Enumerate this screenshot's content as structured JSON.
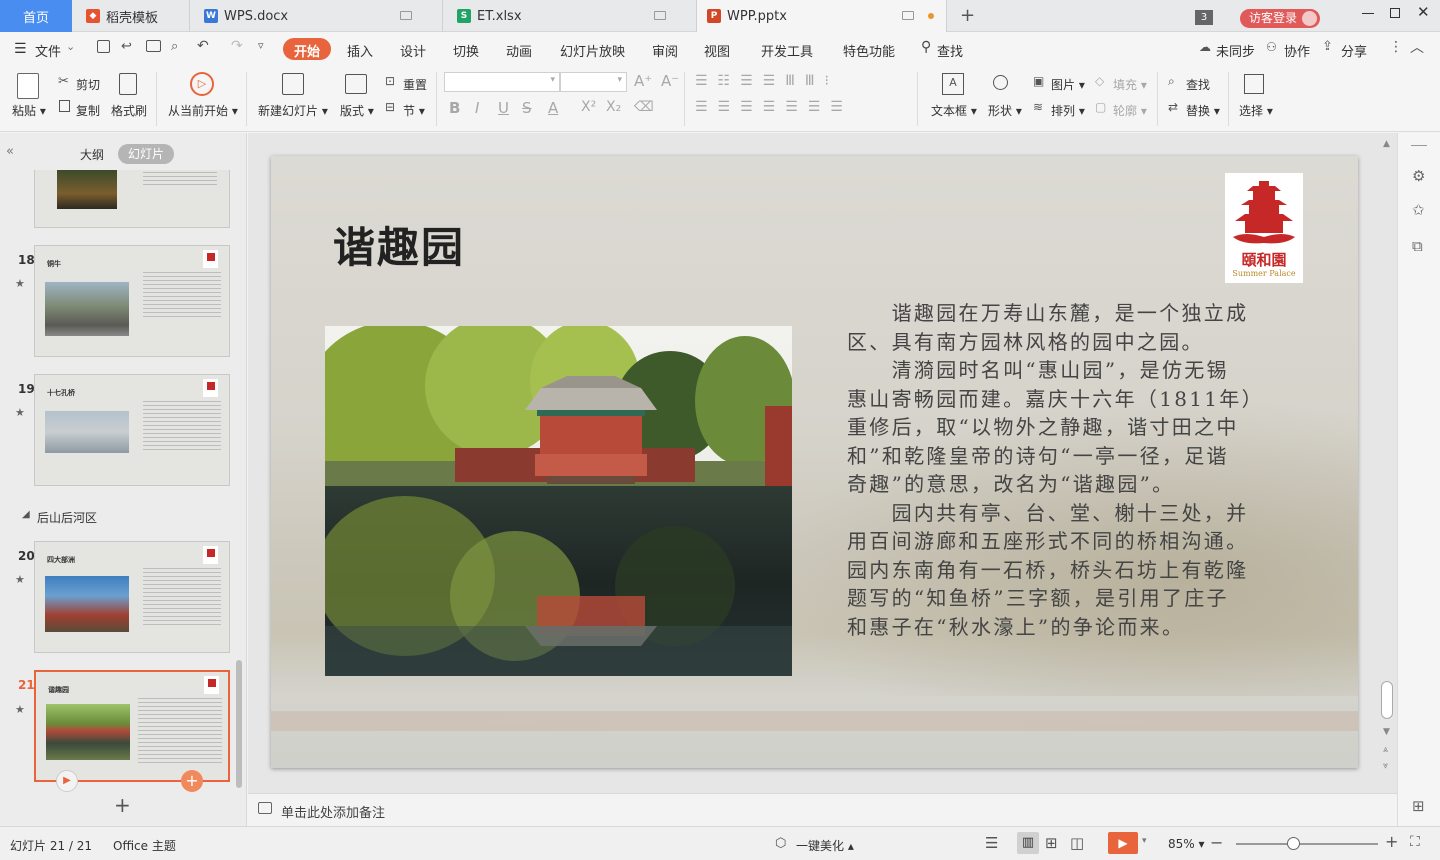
{
  "tabs": {
    "home": "首页",
    "items": [
      {
        "label": "稻壳模板",
        "icon": "daoke-icon"
      },
      {
        "label": "WPS.docx",
        "icon": "docx-icon"
      },
      {
        "label": "ET.xlsx",
        "icon": "xlsx-icon"
      },
      {
        "label": "WPP.pptx",
        "icon": "pptx-icon"
      }
    ],
    "add": "+",
    "badge": "3",
    "login": "访客登录"
  },
  "menu": {
    "file": "文件",
    "items": [
      "开始",
      "插入",
      "设计",
      "切换",
      "动画",
      "幻灯片放映",
      "审阅",
      "视图",
      "开发工具",
      "特色功能"
    ],
    "search": "查找",
    "sync": "未同步",
    "collab": "协作",
    "share": "分享"
  },
  "ribbon": {
    "paste": "粘贴",
    "cut": "剪切",
    "copy": "复制",
    "format_painter": "格式刷",
    "from_current": "从当前开始",
    "new_slide": "新建幻灯片",
    "layout": "版式",
    "reset": "重置",
    "section": "节",
    "textbox": "文本框",
    "shape": "形状",
    "picture": "图片",
    "fill": "填充",
    "arrange": "排列",
    "outline": "轮廓",
    "find": "查找",
    "replace": "替换",
    "select": "选择"
  },
  "left_panel": {
    "outline_tab": "大纲",
    "slides_tab": "幻灯片",
    "section_label": "后山后河区",
    "slides": [
      {
        "num": "18",
        "title": "铜牛"
      },
      {
        "num": "19",
        "title": "十七孔桥"
      },
      {
        "num": "20",
        "title": "四大部洲"
      },
      {
        "num": "21",
        "title": "谐趣园"
      }
    ]
  },
  "slide": {
    "title": "谐趣园",
    "logo_cn": "頤和園",
    "logo_en": "Summer Palace",
    "paragraphs": [
      "谐趣园在万寿山东麓，是一个独立成区、具有南方园林风格的园中之园。",
      "清漪园时名叫“惠山园”，是仿无锡惠山寄畅园而建。嘉庆十六年（1811年）重修后，取“以物外之静趣，谐寸田之中和”和乾隆皇帝的诗句“一亭一径，足谐奇趣”的意思，改名为“谐趣园”。",
      "园内共有亭、台、堂、榭十三处，并用百间游廊和五座形式不同的桥相沟通。园内东南角有一石桥，桥头石坊上有乾隆题写的“知鱼桥”三字额，是引用了庄子和惠子在“秋水濠上”的争论而来。"
    ],
    "lines": [
      "　　谐趣园在万寿山东麓，是一个独立成",
      "区、具有南方园林风格的园中之园。",
      "　　清漪园时名叫“惠山园”，是仿无锡",
      "惠山寄畅园而建。嘉庆十六年（1811年）",
      "重修后，取“以物外之静趣，谐寸田之中",
      "和”和乾隆皇帝的诗句“一亭一径，足谐",
      "奇趣”的意思，改名为“谐趣园”。",
      "　　园内共有亭、台、堂、榭十三处，并",
      "用百间游廊和五座形式不同的桥相沟通。",
      "园内东南角有一石桥，桥头石坊上有乾隆",
      "题写的“知鱼桥”三字额，是引用了庄子",
      "和惠子在“秋水濠上”的争论而来。"
    ]
  },
  "notes_placeholder": "单击此处添加备注",
  "status": {
    "slide_counter": "幻灯片 21 / 21",
    "theme": "Office 主题",
    "beautify": "一键美化",
    "zoom": "85%"
  },
  "colors": {
    "accent": "#e8643c",
    "ppt_orange": "#d24726"
  }
}
